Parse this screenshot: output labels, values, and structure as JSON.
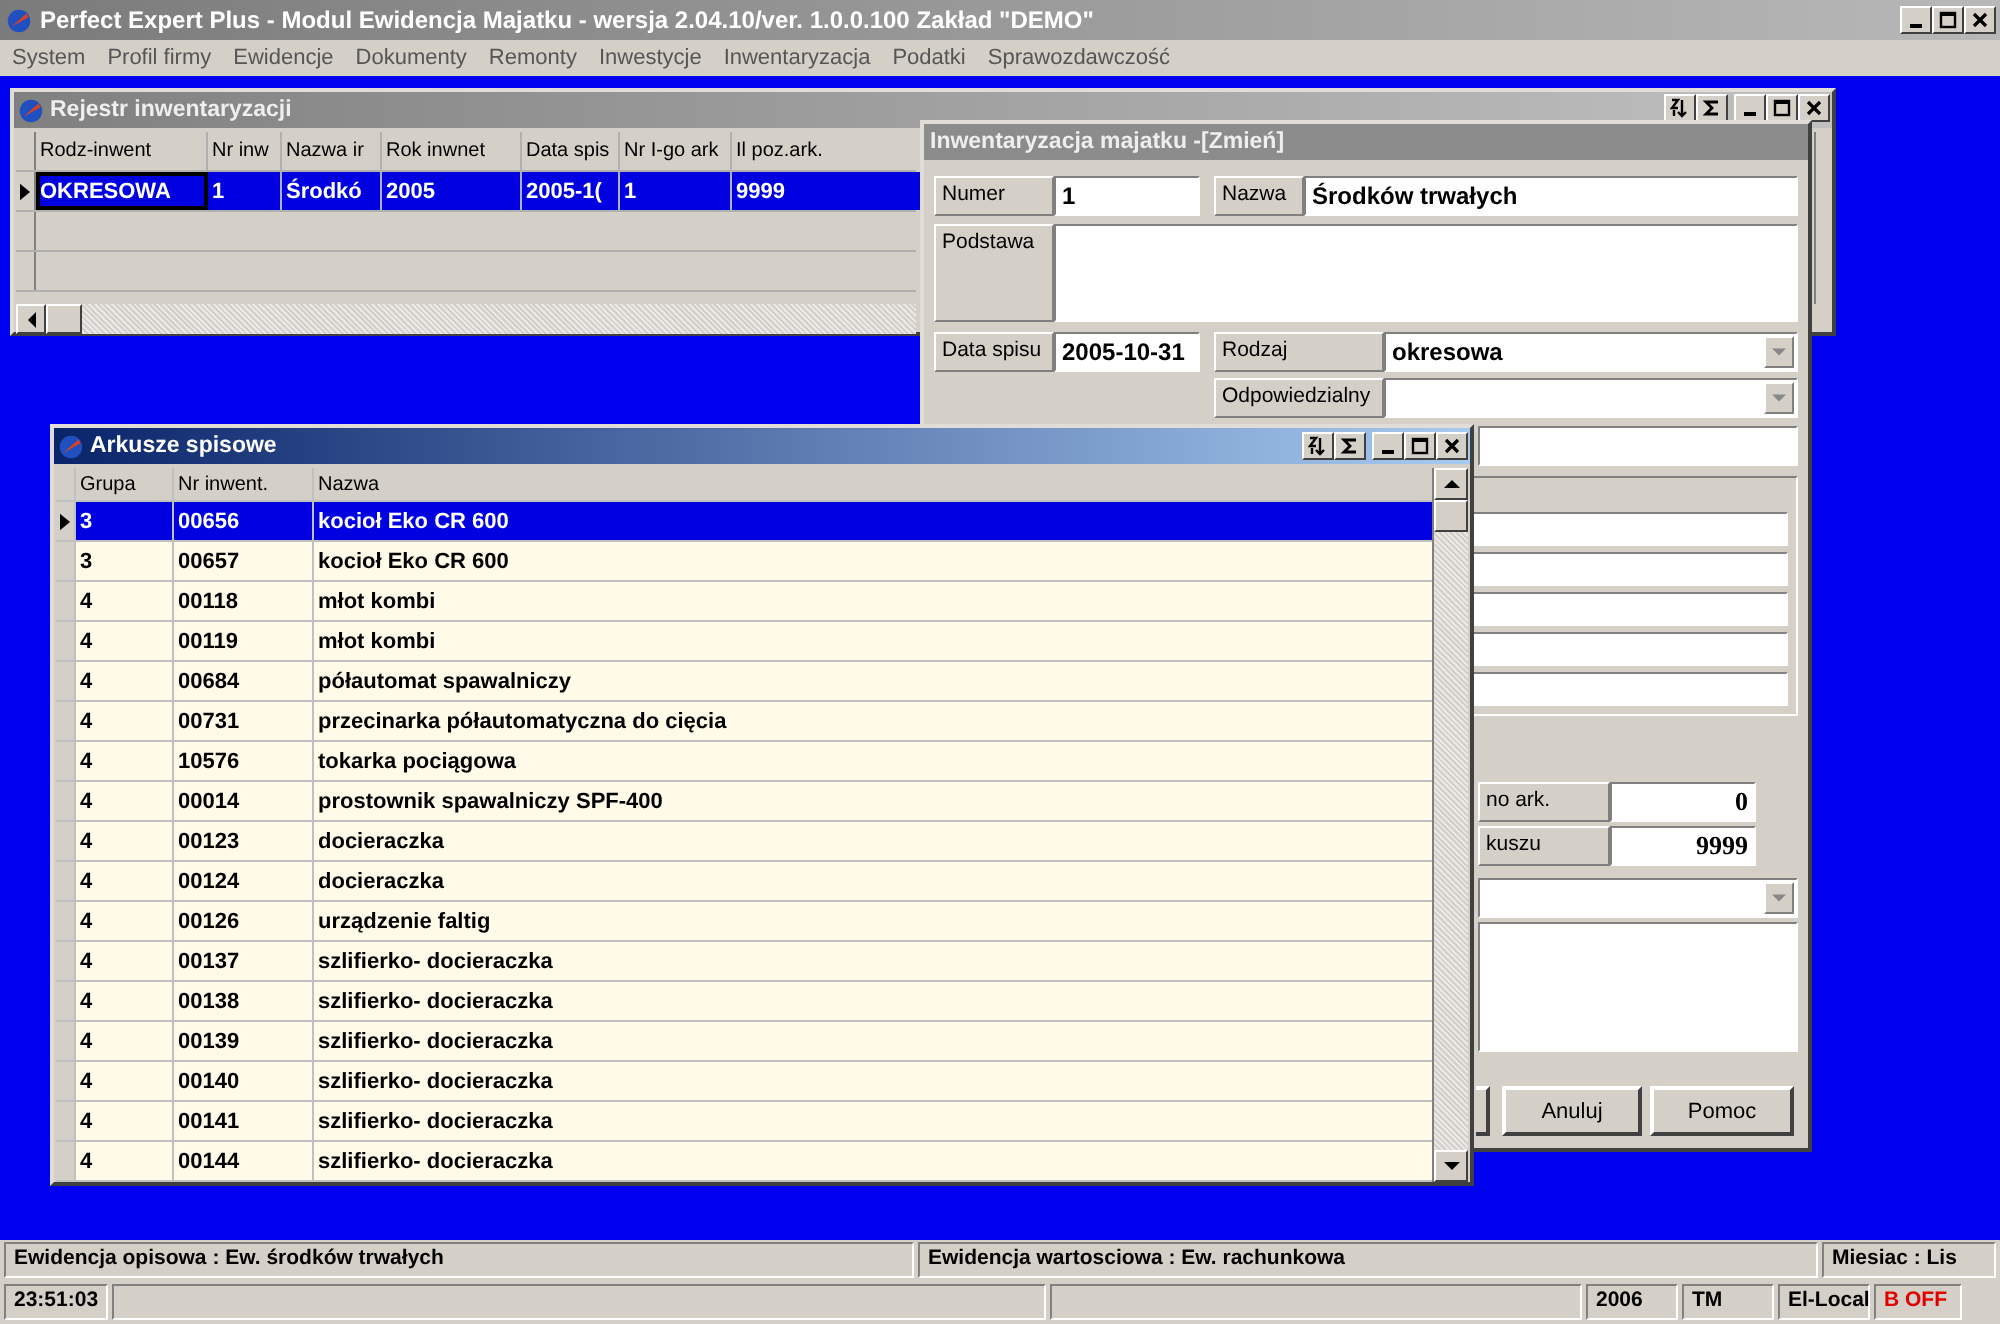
{
  "app_title": "Perfect Expert Plus - Modul Ewidencja Majatku - wersja 2.04.10/ver. 1.0.0.100 Zakład \"DEMO\"",
  "menu": [
    "System",
    "Profil firmy",
    "Ewidencje",
    "Dokumenty",
    "Remonty",
    "Inwestycje",
    "Inwentaryzacja",
    "Podatki",
    "Sprawozdawczość"
  ],
  "register_window": {
    "title": "Rejestr inwentaryzacji",
    "columns": [
      "Rodz-inwent",
      "Nr inw",
      "Nazwa ir",
      "Rok inwnet",
      "Data spis",
      "Nr I-go ark",
      "Il poz.ark."
    ],
    "rows": [
      {
        "cells": [
          "OKRESOWA",
          "1",
          "Środkó",
          "2005",
          "2005-1(",
          "1",
          "9999"
        ],
        "selected": true
      }
    ]
  },
  "dialog": {
    "title": "Inwentaryzacja majatku -[Zmień]",
    "numer_label": "Numer",
    "numer": "1",
    "nazwa_label": "Nazwa",
    "nazwa": "Środków trwałych",
    "podstawa_label": "Podstawa",
    "data_spisu_label": "Data spisu",
    "data_spisu": "2005-10-31",
    "rodzaj_label": "Rodzaj",
    "rodzaj": "okresowa",
    "odpowiedzialny_label": "Odpowiedzialny",
    "count_label": "no ark.",
    "count": "0",
    "sheet_label": "kuszu",
    "sheet_value": "9999",
    "buttons": [
      "Anuluj",
      "Pomoc"
    ]
  },
  "sheets_window": {
    "title": "Arkusze spisowe",
    "columns": [
      "Grupa",
      "Nr inwent.",
      "Nazwa"
    ],
    "rows": [
      {
        "cells": [
          "3",
          "00656",
          "kocioł Eko CR 600"
        ],
        "selected": true
      },
      {
        "cells": [
          "3",
          "00657",
          "kocioł Eko CR 600"
        ],
        "selected": false
      },
      {
        "cells": [
          "4",
          "00118",
          "młot kombi"
        ],
        "selected": false
      },
      {
        "cells": [
          "4",
          "00119",
          "młot kombi"
        ],
        "selected": false
      },
      {
        "cells": [
          "4",
          "00684",
          "półautomat spawalniczy"
        ],
        "selected": false
      },
      {
        "cells": [
          "4",
          "00731",
          "przecinarka półautomatyczna do cięcia"
        ],
        "selected": false
      },
      {
        "cells": [
          "4",
          "10576",
          "tokarka pociągowa"
        ],
        "selected": false
      },
      {
        "cells": [
          "4",
          "00014",
          "prostownik spawalniczy SPF-400"
        ],
        "selected": false
      },
      {
        "cells": [
          "4",
          "00123",
          "docieraczka"
        ],
        "selected": false
      },
      {
        "cells": [
          "4",
          "00124",
          "docieraczka"
        ],
        "selected": false
      },
      {
        "cells": [
          "4",
          "00126",
          "urządzenie faltig"
        ],
        "selected": false
      },
      {
        "cells": [
          "4",
          "00137",
          "szlifierko- docieraczka"
        ],
        "selected": false
      },
      {
        "cells": [
          "4",
          "00138",
          "szlifierko- docieraczka"
        ],
        "selected": false
      },
      {
        "cells": [
          "4",
          "00139",
          "szlifierko- docieraczka"
        ],
        "selected": false
      },
      {
        "cells": [
          "4",
          "00140",
          "szlifierko- docieraczka"
        ],
        "selected": false
      },
      {
        "cells": [
          "4",
          "00141",
          "szlifierko- docieraczka"
        ],
        "selected": false
      },
      {
        "cells": [
          "4",
          "00144",
          "szlifierko- docieraczka"
        ],
        "selected": false
      }
    ]
  },
  "status_bar": [
    "Ewidencja opisowa : Ew. środków  trwałych",
    "Ewidencja wartosciowa : Ew. rachunkowa",
    "Miesiac : Lis"
  ],
  "bottom_bar": [
    {
      "text": "23:51:03",
      "kind": "clock"
    },
    {
      "text": "2006",
      "kind": "text"
    },
    {
      "text": "TM",
      "kind": "text"
    },
    {
      "text": "El-Local",
      "kind": "text"
    },
    {
      "text": "B OFF",
      "kind": "alert"
    }
  ]
}
